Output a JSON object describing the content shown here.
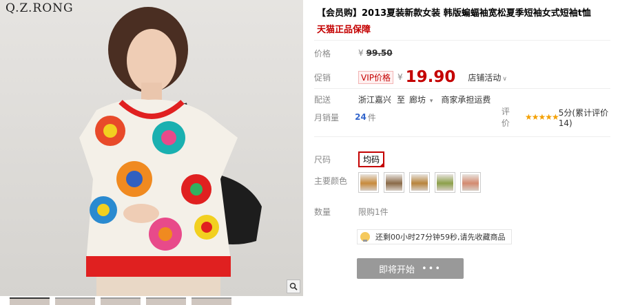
{
  "brand": "Q.Z.RONG",
  "thumbnails": 5,
  "product": {
    "title": "【会员购】2013夏装新款女装 韩版蝙蝠袖宽松夏季短袖女式短袖t恤",
    "guarantee": "天猫正品保障"
  },
  "price": {
    "label": "价格",
    "currency": "¥",
    "original": "99.50"
  },
  "promo": {
    "label": "促销",
    "vip_tag": "VIP价格",
    "currency": "¥",
    "price": "19.90",
    "store_activity": "店铺活动"
  },
  "shipping": {
    "label": "配送",
    "from": "浙江嘉兴",
    "to_word": "至",
    "to": "廊坊",
    "note": "商家承担运费"
  },
  "sales": {
    "label": "月销量",
    "count": "24",
    "unit": "件",
    "rating_label": "评价",
    "rating_text": "5分(累计评价14)",
    "stars": 5
  },
  "size": {
    "label": "尺码",
    "selected": "均码"
  },
  "color": {
    "label": "主要颜色",
    "swatches": [
      "#c78a3c",
      "#8a6a48",
      "#b8843c",
      "#8ca04a",
      "#d48a70"
    ]
  },
  "quantity": {
    "label": "数量",
    "limit": "限购1件"
  },
  "countdown": "还剩00小时27分钟59秒,请先收藏商品",
  "buy_button": {
    "label": "即将开始",
    "dots": "•••"
  },
  "colors": {
    "accent": "#c40000",
    "link": "#3366cc",
    "star": "#f4a000"
  }
}
